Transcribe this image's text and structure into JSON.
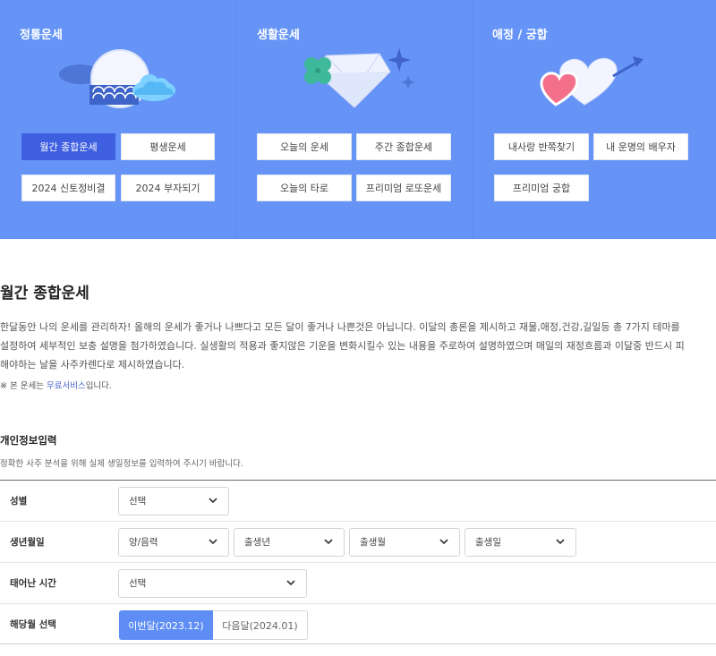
{
  "banner": {
    "columns": [
      {
        "title": "정통운세",
        "illustration": "moon-cloud-wave-icon",
        "buttons": [
          "월간 종합운세",
          "평생운세",
          "2024 신토정비결",
          "2024 부자되기"
        ]
      },
      {
        "title": "생활운세",
        "illustration": "clover-diamond-icon",
        "buttons": [
          "오늘의 운세",
          "주간 종합운세",
          "오늘의 타로",
          "프리미엄 로또운세"
        ]
      },
      {
        "title": "애정 / 궁합",
        "illustration": "hearts-arrow-icon",
        "buttons": [
          "내사랑 반쪽찾기",
          "내 운명의 배우자",
          "프리미엄 궁합"
        ]
      }
    ],
    "active_button": "월간 종합운세",
    "colors": {
      "background": "#6594f6",
      "active": "#3d5fe0"
    }
  },
  "section": {
    "title": "월간 종합운세",
    "description_lines": [
      "한달동안 나의 운세를 관리하자! 올해의 운세가 좋거나 나쁘다고 모든 달이 좋거나 나쁜것은 아닙니다. 이달의 총론을 제시하고 재물,애정,건강,길일등 총 7가지 테마를",
      "설정하여 세부적인 보충 설명을 첨가하였습니다. 실생활의 적용과 좋지않은 기운을 변화시킬수 있는 내용을 주로하여 설명하였으며 매일의 재정흐름과 이달중 반드시 피",
      "해야하는 날을 사주카렌다로 제시하였습니다."
    ],
    "note_prefix": "※ 본 운세는 ",
    "note_link": "무료서비스",
    "note_suffix": "입니다."
  },
  "form": {
    "title": "개인정보입력",
    "subtitle": "정확한 사주 분석을 위해 실제 생일정보를 입력하여 주시기 바랍니다.",
    "gender": {
      "label": "성별",
      "value": "선택"
    },
    "birth": {
      "label": "생년월일",
      "calendar": "양/음력",
      "year": "출생년",
      "month": "출생월",
      "day": "출생일"
    },
    "time": {
      "label": "태어난 시간",
      "value": "선택"
    },
    "month_select": {
      "label": "해당월 선택",
      "current": "이번달(2023.12)",
      "next": "다음달(2024.01)",
      "selected": "이번달(2023.12)"
    },
    "accent": "#5e8df5"
  }
}
